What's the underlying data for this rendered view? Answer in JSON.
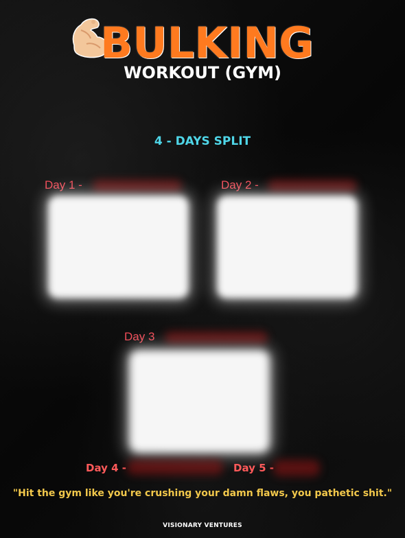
{
  "header": {
    "title": "BULKING",
    "subtitle": "WORKOUT (GYM)",
    "icon": "flexed-arm-icon",
    "accent_color": "#ff7a1f"
  },
  "split": {
    "label": "4 - DAYS SPLIT",
    "color": "#4fd6e8"
  },
  "days": [
    {
      "label": "Day 1 -"
    },
    {
      "label": "Day 2 -"
    },
    {
      "label": "Day 3"
    },
    {
      "label": "Day 4 -"
    },
    {
      "label": "Day 5 -"
    }
  ],
  "quote": "\"Hit the gym like you're crushing your damn flaws, you pathetic shit.\"",
  "footer": "VISIONARY VENTURES"
}
